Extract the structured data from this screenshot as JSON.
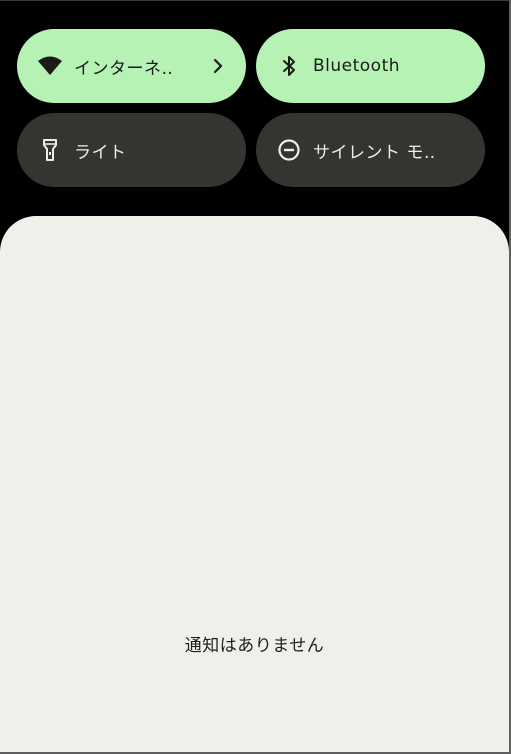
{
  "quick_settings": {
    "tiles": [
      {
        "id": "internet",
        "label": "インターネ‥",
        "icon": "wifi-icon",
        "state": "on",
        "has_chevron": true
      },
      {
        "id": "bluetooth",
        "label": "Bluetooth",
        "icon": "bluetooth-icon",
        "state": "on",
        "has_chevron": false
      },
      {
        "id": "light",
        "label": "ライト",
        "icon": "flashlight-icon",
        "state": "off",
        "has_chevron": false
      },
      {
        "id": "dnd",
        "label": "サイレント モ‥",
        "icon": "do-not-disturb-icon",
        "state": "off",
        "has_chevron": false
      }
    ]
  },
  "notifications": {
    "empty_message": "通知はありません"
  },
  "colors": {
    "tile_on": "#b5f2b4",
    "tile_off": "#343531",
    "panel_background": "#f0f0eb",
    "background": "#000000"
  }
}
